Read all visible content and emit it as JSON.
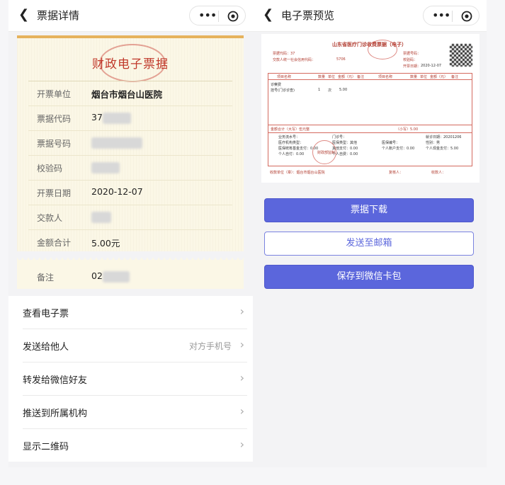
{
  "left": {
    "nav_title": "票据详情",
    "receipt": {
      "title": "财政电子票据",
      "fields": [
        {
          "label": "开票单位",
          "value": "烟台市烟台山医院"
        },
        {
          "label": "票据代码",
          "value": "37"
        },
        {
          "label": "票据号码",
          "value": ""
        },
        {
          "label": "校验码",
          "value": ""
        },
        {
          "label": "开票日期",
          "value": "2020-12-07"
        },
        {
          "label": "交款人",
          "value": ""
        },
        {
          "label": "金额合计",
          "value": "5.00元"
        }
      ],
      "remark_label": "备注",
      "remark_value": "02"
    },
    "menu": [
      {
        "label": "查看电子票",
        "hint": ""
      },
      {
        "label": "发送给他人",
        "hint": "对方手机号"
      },
      {
        "label": "转发给微信好友",
        "hint": ""
      },
      {
        "label": "推送到所属机构",
        "hint": ""
      },
      {
        "label": "显示二维码",
        "hint": ""
      }
    ]
  },
  "right": {
    "nav_title": "电子票预览",
    "doc": {
      "title": "山东省医疗门诊收费票据（电子）",
      "code_label": "票据代码：37",
      "number_label": "票据号码：",
      "check_label": "校验码：",
      "date_label": "开票日期：",
      "date_value": "2020-12-07",
      "payer_label": "交款人统一社会信用代码：",
      "payer_value": "5706",
      "header_items": [
        "项目名称",
        "数量",
        "单位",
        "金额（元）",
        "备注",
        "项目名称",
        "数量",
        "单位",
        "金额（元）",
        "备注"
      ],
      "item_1": "诊察费",
      "item_2": "挂号(门诊诊查)",
      "item_qty": "1",
      "item_unit": "次",
      "item_amount": "5.00",
      "total_label": "金额合计（大写）伍元整",
      "total_small": "（小写）5.00",
      "info_lines": [
        "业务流水号：",
        "门诊号：",
        "就诊日期：20201206",
        "医疗机构类型：",
        "医保类型：其他",
        "医保编号：",
        "性别：男",
        "医保统筹基金支付：0.00",
        "其他支付：0.00",
        "个人账户支付：0.00",
        "个人现金支付：5.00",
        "个人自付：0.00",
        "个人自费：0.00"
      ],
      "footer_left": "收款单位（章）：烟台市烟台山医院",
      "footer_mid": "复核人：",
      "footer_right": "收款人：",
      "seal_text": "财政部监制"
    },
    "buttons": {
      "download": "票据下载",
      "email": "发送至邮箱",
      "wechat_card": "保存到微信卡包"
    }
  },
  "colors": {
    "accent": "#5b66dc",
    "receipt_red": "#c0392b",
    "receipt_gold": "#e6b25c"
  },
  "icons": {
    "back": "chevron-left-icon",
    "more": "more-dots-icon",
    "close": "target-circle-icon",
    "chevron": "chevron-right-icon"
  }
}
